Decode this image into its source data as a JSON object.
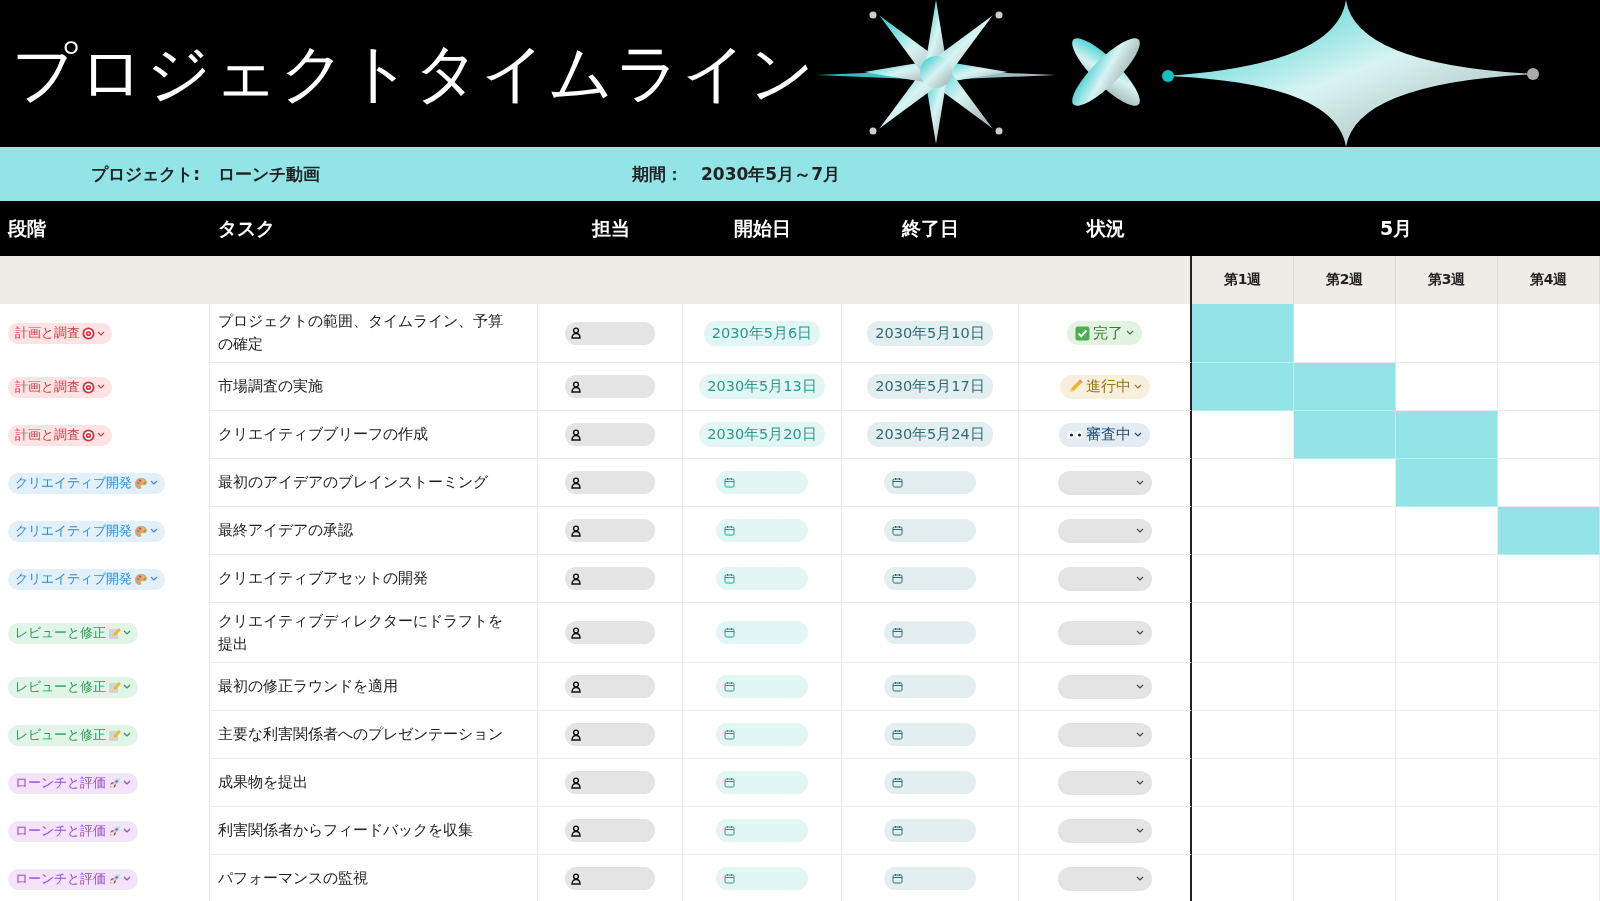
{
  "title": "プロジェクトタイムライン",
  "info": {
    "project_label": "プロジェクト:",
    "project_value": "ローンチ動画",
    "period_label": "期間：",
    "period_value": "2030年5月～7月"
  },
  "columns": [
    "段階",
    "タスク",
    "担当",
    "開始日",
    "終了日",
    "状況"
  ],
  "month": "5月",
  "weeks": [
    "第1週",
    "第2週",
    "第3週",
    "第4週"
  ],
  "rows": [
    {
      "phase": {
        "label": "計画と調査",
        "kind": "plan"
      },
      "task": "プロジェクトの範囲、タイムライン、予算の確定",
      "start": "2030年5月6日",
      "end": "2030年5月10日",
      "status": {
        "label": "完了",
        "kind": "done"
      },
      "weeks": [
        {
          "filled": true
        },
        {
          "filled": false
        },
        {
          "filled": false
        },
        {
          "filled": false
        }
      ]
    },
    {
      "phase": {
        "label": "計画と調査",
        "kind": "plan"
      },
      "task": "市場調査の実施",
      "start": "2030年5月13日",
      "end": "2030年5月17日",
      "status": {
        "label": "進行中",
        "kind": "progress"
      },
      "weeks": [
        {
          "filled": true
        },
        {
          "filled": true
        },
        {
          "filled": false
        },
        {
          "filled": false
        }
      ]
    },
    {
      "phase": {
        "label": "計画と調査",
        "kind": "plan"
      },
      "task": "クリエイティブブリーフの作成",
      "start": "2030年5月20日",
      "end": "2030年5月24日",
      "status": {
        "label": "審査中",
        "kind": "review"
      },
      "weeks": [
        {
          "filled": false
        },
        {
          "filled": true
        },
        {
          "filled": true
        },
        {
          "filled": false
        }
      ]
    },
    {
      "phase": {
        "label": "クリエイティブ開発",
        "kind": "creative"
      },
      "task": "最初のアイデアのブレインストーミング",
      "status": {
        "kind": "none"
      },
      "weeks": [
        {
          "filled": false
        },
        {
          "filled": false
        },
        {
          "filled": true
        },
        {
          "filled": false
        }
      ]
    },
    {
      "phase": {
        "label": "クリエイティブ開発",
        "kind": "creative"
      },
      "task": "最終アイデアの承認",
      "status": {
        "kind": "none"
      },
      "weeks": [
        {
          "filled": false
        },
        {
          "filled": false
        },
        {
          "filled": false
        },
        {
          "filled": true
        }
      ]
    },
    {
      "phase": {
        "label": "クリエイティブ開発",
        "kind": "creative"
      },
      "task": "クリエイティブアセットの開発",
      "status": {
        "kind": "none"
      },
      "weeks": [
        {
          "filled": false
        },
        {
          "filled": false
        },
        {
          "filled": false
        },
        {
          "filled": false
        }
      ]
    },
    {
      "phase": {
        "label": "レビューと修正",
        "kind": "review"
      },
      "task": "クリエイティブディレクターにドラフトを提出",
      "status": {
        "kind": "none"
      },
      "weeks": [
        {
          "filled": false
        },
        {
          "filled": false
        },
        {
          "filled": false
        },
        {
          "filled": false
        }
      ]
    },
    {
      "phase": {
        "label": "レビューと修正",
        "kind": "review"
      },
      "task": "最初の修正ラウンドを適用",
      "status": {
        "kind": "none"
      },
      "weeks": [
        {
          "filled": false
        },
        {
          "filled": false
        },
        {
          "filled": false
        },
        {
          "filled": false
        }
      ]
    },
    {
      "phase": {
        "label": "レビューと修正",
        "kind": "review"
      },
      "task": "主要な利害関係者へのプレゼンテーション",
      "status": {
        "kind": "none"
      },
      "weeks": [
        {
          "filled": false
        },
        {
          "filled": false
        },
        {
          "filled": false
        },
        {
          "filled": false
        }
      ]
    },
    {
      "phase": {
        "label": "ローンチと評価",
        "kind": "launch"
      },
      "task": "成果物を提出",
      "status": {
        "kind": "none"
      },
      "weeks": [
        {
          "filled": false
        },
        {
          "filled": false
        },
        {
          "filled": false
        },
        {
          "filled": false
        }
      ]
    },
    {
      "phase": {
        "label": "ローンチと評価",
        "kind": "launch"
      },
      "task": "利害関係者からフィードバックを収集",
      "status": {
        "kind": "none"
      },
      "weeks": [
        {
          "filled": false
        },
        {
          "filled": false
        },
        {
          "filled": false
        },
        {
          "filled": false
        }
      ]
    },
    {
      "phase": {
        "label": "ローンチと評価",
        "kind": "launch"
      },
      "task": "パフォーマンスの監視",
      "status": {
        "kind": "none"
      },
      "weeks": [
        {
          "filled": false
        },
        {
          "filled": false
        },
        {
          "filled": false
        },
        {
          "filled": false
        }
      ]
    }
  ]
}
